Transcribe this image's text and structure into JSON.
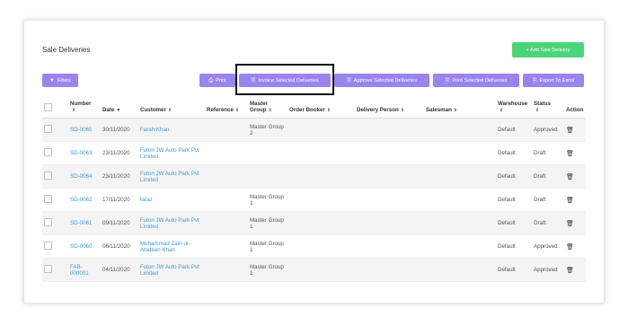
{
  "page": {
    "title": "Sale Deliveries"
  },
  "buttons": {
    "add": "+ Add Sale Delivery",
    "filters": "Filters",
    "print": "Print",
    "invoice_selected": "Invoice Selected Deliveries",
    "approve_selected": "Approve Selected Deliveries",
    "print_selected": "Print Selected Deliveries",
    "export": "Export To Excel"
  },
  "colors": {
    "green": "#4cd47a",
    "purple": "#9b84ee",
    "link": "#3d9ad8"
  },
  "table": {
    "headers": {
      "number": "Number",
      "date": "Date",
      "customer": "Customer",
      "reference": "Reference",
      "master_group": "Master Group",
      "order_booker": "Order Booker",
      "delivery_person": "Delivery Person",
      "salesman": "Salesman",
      "warehouse": "Warehouse",
      "status": "Status",
      "action": "Action"
    },
    "rows": [
      {
        "number": "SD-0065",
        "date": "30/11/2020",
        "customer": "Farah Khan",
        "master_group": "Master Group 2",
        "warehouse": "Default",
        "status": "Approved"
      },
      {
        "number": "SD-0063",
        "date": "23/11/2020",
        "customer": "Futon JW Auto Park Pvt Limited",
        "master_group": "",
        "warehouse": "Default",
        "status": "Draft"
      },
      {
        "number": "SD-0064",
        "date": "23/11/2020",
        "customer": "Futon JW Auto Park Pvt Limited",
        "master_group": "",
        "warehouse": "Default",
        "status": "Draft"
      },
      {
        "number": "SD-0062",
        "date": "17/11/2020",
        "customer": "faraz",
        "master_group": "Master Group 1",
        "warehouse": "Default",
        "status": "Draft"
      },
      {
        "number": "SD-0061",
        "date": "09/11/2020",
        "customer": "Futon JW Auto Park Pvt Limited",
        "master_group": "Master Group 1",
        "warehouse": "Default",
        "status": "Draft"
      },
      {
        "number": "SD-0060",
        "date": "06/11/2020",
        "customer": "Muhammad Zain-ul-Abideen Khan",
        "master_group": "Master Group 1",
        "warehouse": "Default",
        "status": "Approved"
      },
      {
        "number": "FAB-000001",
        "date": "04/11/2020",
        "customer": "Futon JW Auto Park Pvt Limited",
        "master_group": "Master Group 1",
        "warehouse": "Default",
        "status": "Approved"
      }
    ]
  }
}
